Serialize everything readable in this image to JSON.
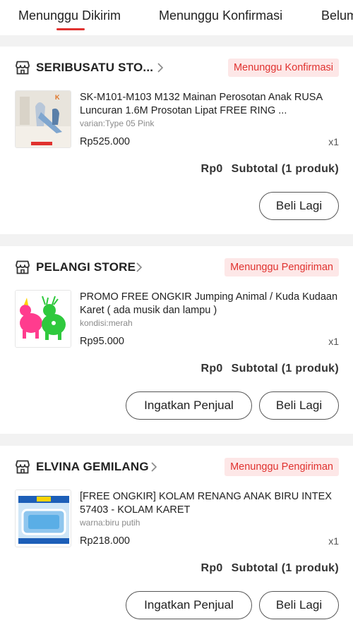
{
  "tabs": [
    {
      "label": "Menunggu Dikirim",
      "active": true
    },
    {
      "label": "Menunggu Konfirmasi",
      "active": false
    },
    {
      "label": "Belum Dibayar",
      "active": false
    }
  ],
  "accent_color": "#e0322f",
  "orders": [
    {
      "store": "SERIBUSATU STO...",
      "status": "Menunggu Konfirmasi",
      "product_title": "SK-M101-M103 M132 Mainan Perosotan Anak RUSA Luncuran 1.6M Prosotan Lipat FREE RING ...",
      "variant": "varian:Type 05 Pink",
      "price": "Rp525.000",
      "qty": "x1",
      "subtotal_amount": "Rp0",
      "subtotal_label": "Subtotal (1 produk)",
      "buttons": {
        "buy_again": "Beli Lagi"
      }
    },
    {
      "store": "PELANGI STORE",
      "status": "Menunggu Pengiriman",
      "product_title": "PROMO FREE ONGKIR Jumping Animal / Kuda Kudaan Karet ( ada musik dan lampu )",
      "variant": "kondisi:merah",
      "price": "Rp95.000",
      "qty": "x1",
      "subtotal_amount": "Rp0",
      "subtotal_label": "Subtotal (1 produk)",
      "buttons": {
        "remind_seller": "Ingatkan Penjual",
        "buy_again": "Beli Lagi"
      }
    },
    {
      "store": "ELVINA GEMILANG",
      "status": "Menunggu Pengiriman",
      "product_title": "[FREE ONGKIR] KOLAM RENANG ANAK BIRU INTEX 57403 - KOLAM KARET",
      "variant": "warna:biru putih",
      "price": "Rp218.000",
      "qty": "x1",
      "subtotal_amount": "Rp0",
      "subtotal_label": "Subtotal (1 produk)",
      "buttons": {
        "remind_seller": "Ingatkan Penjual",
        "buy_again": "Beli Lagi"
      }
    }
  ]
}
